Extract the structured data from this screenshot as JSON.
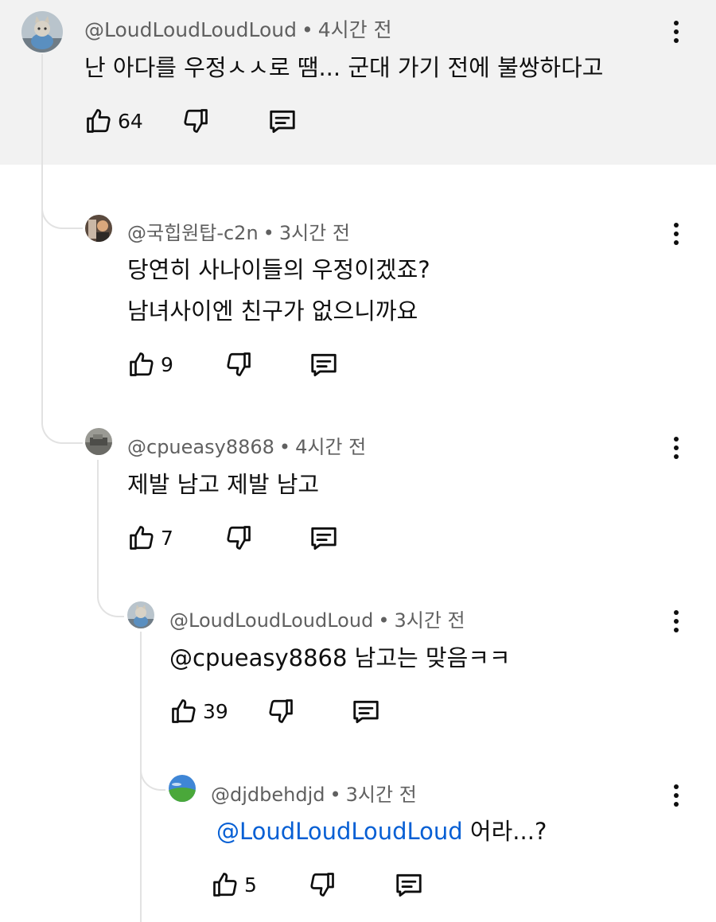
{
  "comments": [
    {
      "handle": "@LoudLoudLoudLoud",
      "separator": "•",
      "time": "4시간 전",
      "lines": [
        "난 아다를 우정ㅅㅅ로 땜... 군대 가기 전에 불쌍하다고"
      ],
      "likes": "64",
      "avatar_icon": "cat-avatar-icon"
    },
    {
      "handle": "@국힙원탑-c2n",
      "separator": "•",
      "time": "3시간 전",
      "lines": [
        "당연히 사나이들의 우정이겠죠?",
        "남녀사이엔 친구가 없으니까요"
      ],
      "likes": "9",
      "avatar_icon": "person-avatar-icon"
    },
    {
      "handle": "@cpueasy8868",
      "separator": "•",
      "time": "4시간 전",
      "lines": [
        "제발 남고 제발 남고"
      ],
      "likes": "7",
      "avatar_icon": "photo-avatar-icon"
    },
    {
      "handle": "@LoudLoudLoudLoud",
      "separator": "•",
      "time": "3시간 전",
      "lines": [
        "@cpueasy8868 남고는 맞음ㅋㅋ"
      ],
      "likes": "39",
      "avatar_icon": "cat-avatar-icon"
    },
    {
      "handle": "@djdbehdjd",
      "separator": "•",
      "time": "3시간 전",
      "mention": "@LoudLoudLoudLoud",
      "rest": " 어라...?",
      "likes": "5",
      "avatar_icon": "landscape-avatar-icon"
    }
  ],
  "colors": {
    "highlight_bg": "#f2f2f2",
    "mention": "#065fd4",
    "meta_text": "#606060"
  }
}
